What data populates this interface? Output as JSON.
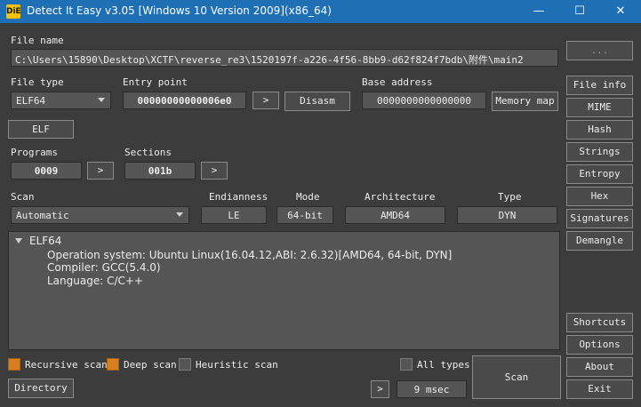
{
  "window": {
    "title": "Detect It Easy v3.05 [Windows 10 Version 2009](x86_64)",
    "icon_label": "DiE",
    "minimize_glyph": "—",
    "maximize_glyph": "☐",
    "close_glyph": "✕"
  },
  "file": {
    "label": "File name",
    "path": "C:\\Users\\15890\\Desktop\\XCTF\\reverse_re3\\1520197f-a226-4f56-8bb9-d62f824f7bdb\\附件\\main2",
    "browse_label": "..."
  },
  "file_type": {
    "label": "File type",
    "value": "ELF64"
  },
  "entry_point": {
    "label": "Entry point",
    "value": "00000000000006e0",
    "next_label": ">",
    "disasm_label": "Disasm"
  },
  "base_address": {
    "label": "Base address",
    "value": "0000000000000000",
    "memory_map_label": "Memory map"
  },
  "elf_button": "ELF",
  "programs": {
    "label": "Programs",
    "value": "0009",
    "next_label": ">"
  },
  "sections": {
    "label": "Sections",
    "value": "001b",
    "next_label": ">"
  },
  "scan": {
    "label": "Scan",
    "mode": "Automatic"
  },
  "info": {
    "endianness": {
      "label": "Endianness",
      "value": "LE"
    },
    "mode": {
      "label": "Mode",
      "value": "64-bit"
    },
    "architecture": {
      "label": "Architecture",
      "value": "AMD64"
    },
    "type": {
      "label": "Type",
      "value": "DYN"
    }
  },
  "results": {
    "root": "ELF64",
    "lines": [
      "Operation system: Ubuntu Linux(16.04.12,ABI: 2.6.32)[AMD64, 64-bit, DYN]",
      "Compiler: GCC(5.4.0)",
      "Language: C/C++"
    ]
  },
  "options": {
    "recursive": {
      "label": "Recursive scan",
      "checked": true
    },
    "deep": {
      "label": "Deep scan",
      "checked": true
    },
    "heuristic": {
      "label": "Heuristic scan",
      "checked": false
    },
    "all_types": {
      "label": "All types",
      "checked": false
    }
  },
  "directory_label": "Directory",
  "log_next_label": ">",
  "scan_time": "9 msec",
  "scan_button": "Scan",
  "side": {
    "file_info": "File info",
    "mime": "MIME",
    "hash": "Hash",
    "strings": "Strings",
    "entropy": "Entropy",
    "hex": "Hex",
    "signatures": "Signatures",
    "demangle": "Demangle",
    "shortcuts": "Shortcuts",
    "options": "Options",
    "about": "About",
    "exit": "Exit"
  },
  "colors": {
    "titlebar": "#1f6fb5",
    "background": "#3c3c3c",
    "field": "#555555",
    "checkbox_on": "#d87f22"
  }
}
